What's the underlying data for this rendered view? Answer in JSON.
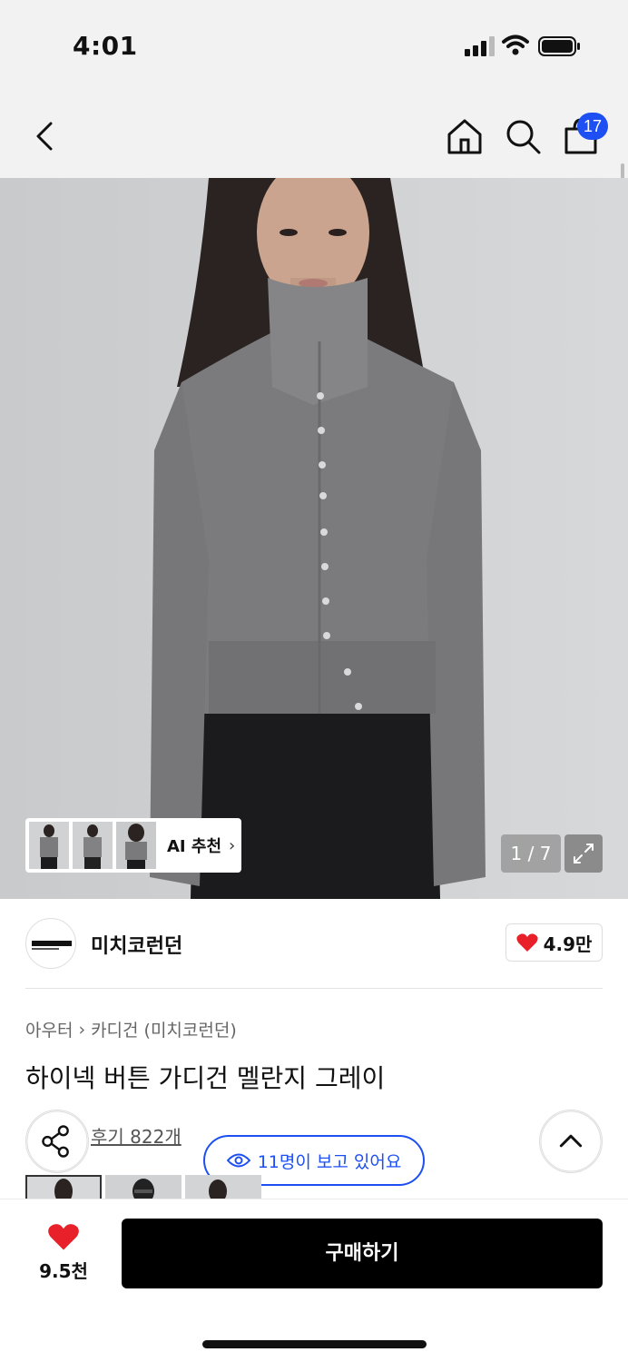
{
  "status_bar": {
    "time": "4:01"
  },
  "nav": {
    "cart_count": "17"
  },
  "hero": {
    "ai_label": "AI 추천",
    "pager": "1 / 7"
  },
  "brand": {
    "logo_text": "MICHICORE LONDON",
    "name": "미치코런던",
    "likes": "4.9만"
  },
  "product": {
    "breadcrumb": [
      "아우터",
      "카디건 (미치코런던)"
    ],
    "title": "하이넥 버튼 가디건 멜란지 그레이",
    "reviews": "후기 822개",
    "viewers": "11명이 보고 있어요"
  },
  "bottom": {
    "wish_count": "9.5천",
    "buy_label": "구매하기"
  },
  "colors": {
    "accent": "#1d4ff2",
    "heart": "#e8202a",
    "buy": "#000000"
  }
}
